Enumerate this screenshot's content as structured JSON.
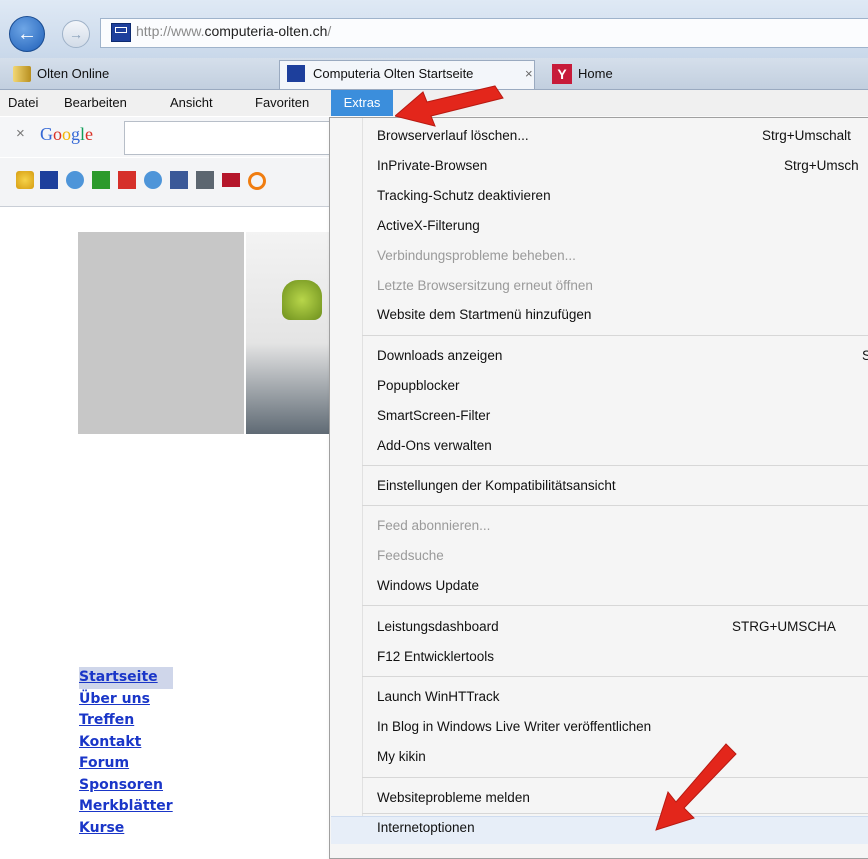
{
  "address_bar": {
    "url_prefix": "http://www.",
    "url_domain": "computeria-olten.ch",
    "url_suffix": "/"
  },
  "tabs": [
    {
      "label": "Olten Online"
    },
    {
      "label": "Computeria Olten Startseite",
      "close": "×"
    },
    {
      "label": "Home"
    }
  ],
  "menu_bar": {
    "items": [
      "Datei",
      "Bearbeiten",
      "Ansicht",
      "Favoriten",
      "Extras"
    ]
  },
  "google_toolbar": {
    "close": "×",
    "logo": "Google"
  },
  "page": {
    "nav_links": [
      "Startseite",
      "Über uns",
      "Treffen",
      "Kontakt",
      "Forum",
      "Sponsoren",
      "Merkblätter",
      "Kurse"
    ]
  },
  "extras_menu": {
    "items": [
      {
        "label": "Browserverlauf löschen...",
        "shortcut": "Strg+Umschalt",
        "disabled": false
      },
      {
        "label": "InPrivate-Browsen",
        "shortcut": "Strg+Umsch",
        "disabled": false
      },
      {
        "label": "Tracking-Schutz deaktivieren",
        "shortcut": "",
        "disabled": false
      },
      {
        "label": "ActiveX-Filterung",
        "shortcut": "",
        "disabled": false
      },
      {
        "label": "Verbindungsprobleme beheben...",
        "shortcut": "",
        "disabled": true
      },
      {
        "label": "Letzte Browsersitzung erneut öffnen",
        "shortcut": "",
        "disabled": true
      },
      {
        "label": "Website dem Startmenü hinzufügen",
        "shortcut": "",
        "disabled": false
      },
      {
        "label": "Downloads anzeigen",
        "shortcut": "",
        "disabled": false
      },
      {
        "label": "Popupblocker",
        "shortcut": "",
        "disabled": false
      },
      {
        "label": "SmartScreen-Filter",
        "shortcut": "",
        "disabled": false
      },
      {
        "label": "Add-Ons verwalten",
        "shortcut": "",
        "disabled": false
      },
      {
        "label": "Einstellungen der Kompatibilitätsansicht",
        "shortcut": "",
        "disabled": false
      },
      {
        "label": "Feed abonnieren...",
        "shortcut": "",
        "disabled": true
      },
      {
        "label": "Feedsuche",
        "shortcut": "",
        "disabled": true
      },
      {
        "label": "Windows Update",
        "shortcut": "",
        "disabled": false
      },
      {
        "label": "Leistungsdashboard",
        "shortcut": "STRG+UMSCHA",
        "disabled": false
      },
      {
        "label": "F12 Entwicklertools",
        "shortcut": "",
        "disabled": false
      },
      {
        "label": "Launch WinHTTrack",
        "shortcut": "",
        "disabled": false
      },
      {
        "label": "In Blog in Windows Live Writer veröffentlichen",
        "shortcut": "",
        "disabled": false
      },
      {
        "label": "My kikin",
        "shortcut": "",
        "disabled": false
      },
      {
        "label": "Websiteprobleme melden",
        "shortcut": "",
        "disabled": false
      },
      {
        "label": "Internetoptionen",
        "shortcut": "",
        "disabled": false
      }
    ]
  },
  "colors": {
    "menu_highlight": "#3b8edc",
    "link": "#1a36c8",
    "annotation_arrow": "#e3261b"
  }
}
